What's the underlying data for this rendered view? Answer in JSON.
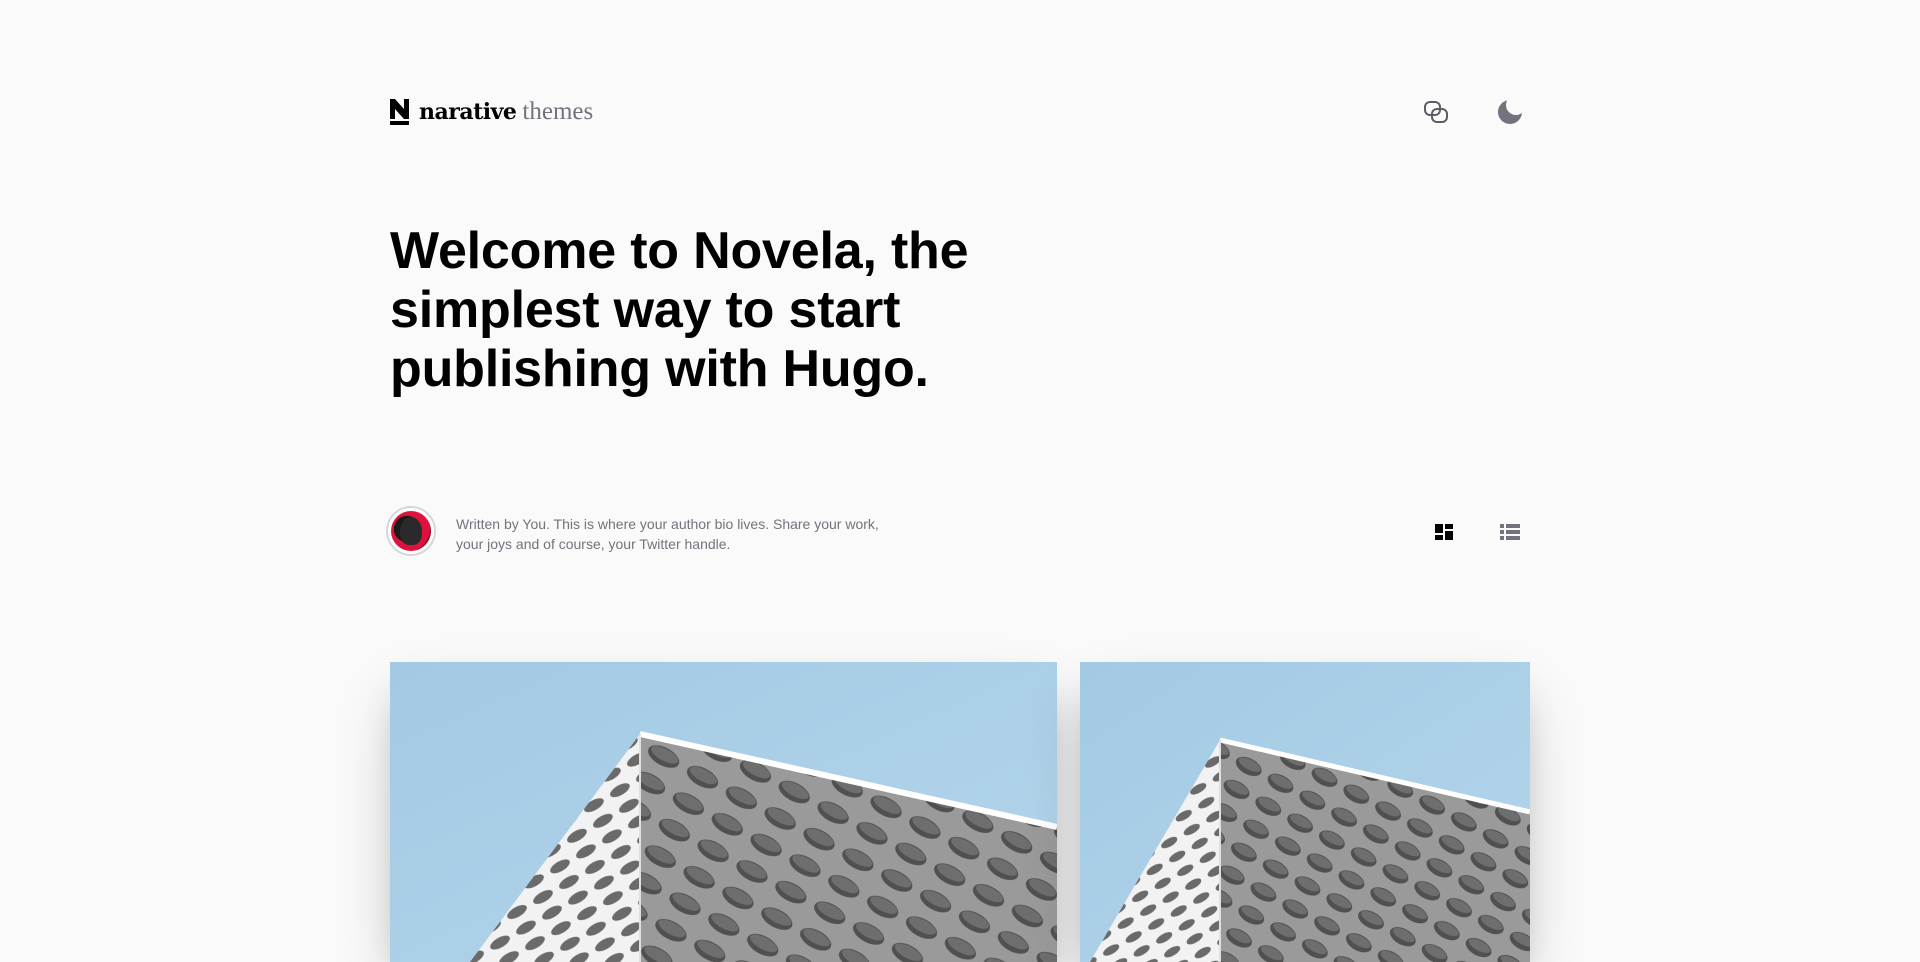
{
  "header": {
    "logo": {
      "word1": "narative",
      "word2": "themes"
    },
    "icons": [
      "copy-link-icon",
      "moon-icon"
    ]
  },
  "hero": {
    "title": "Welcome to Novela, the simplest way to start publishing with Hugo."
  },
  "author": {
    "bio": "Written by You. This is where your author bio lives. Share your work, your joys and of course, your Twitter handle."
  },
  "layout_toggles": [
    "grid-layout-icon",
    "rows-layout-icon"
  ],
  "articles": [
    {
      "image": "building-facade-image"
    },
    {
      "image": "building-facade-image"
    }
  ],
  "colors": {
    "background": "#fafafa",
    "text": "#000000",
    "muted": "#73737d",
    "sky": "#a9cfe6"
  }
}
